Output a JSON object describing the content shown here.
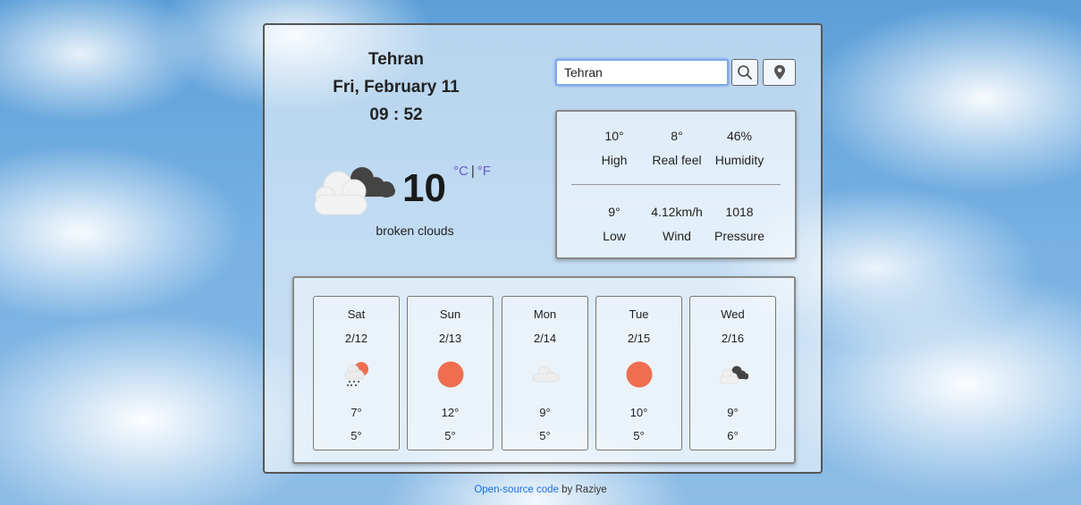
{
  "location": {
    "city": "Tehran",
    "date": "Fri, February 11",
    "time": "09 : 52"
  },
  "current": {
    "temperature": "10",
    "unit_c": "°C",
    "unit_sep": "|",
    "unit_f": "°F",
    "description": "broken clouds",
    "icon": "broken-clouds-icon"
  },
  "search": {
    "value": "Tehran",
    "search_icon": "search-icon",
    "location_icon": "location-pin-icon"
  },
  "stats": [
    {
      "value": "10°",
      "label": "High"
    },
    {
      "value": "8°",
      "label": "Real feel"
    },
    {
      "value": "46%",
      "label": "Humidity"
    },
    {
      "value": "9°",
      "label": "Low"
    },
    {
      "value": "4.12km/h",
      "label": "Wind"
    },
    {
      "value": "1018",
      "label": "Pressure"
    }
  ],
  "forecast": [
    {
      "day": "Sat",
      "date": "2/12",
      "icon": "sun-rain-icon",
      "high": "7°",
      "low": "5°"
    },
    {
      "day": "Sun",
      "date": "2/13",
      "icon": "sun-icon",
      "high": "12°",
      "low": "5°"
    },
    {
      "day": "Mon",
      "date": "2/14",
      "icon": "cloud-icon",
      "high": "9°",
      "low": "5°"
    },
    {
      "day": "Tue",
      "date": "2/15",
      "icon": "sun-icon",
      "high": "10°",
      "low": "5°"
    },
    {
      "day": "Wed",
      "date": "2/16",
      "icon": "broken-clouds-icon",
      "high": "9°",
      "low": "6°"
    }
  ],
  "footer": {
    "link": "Open-source code",
    "suffix": " by Raziye"
  },
  "colors": {
    "sun": "#ee6e4f",
    "unit_accent": "#6a5acd",
    "link": "#1a6fe0",
    "search_focus": "#7ea7e8"
  }
}
